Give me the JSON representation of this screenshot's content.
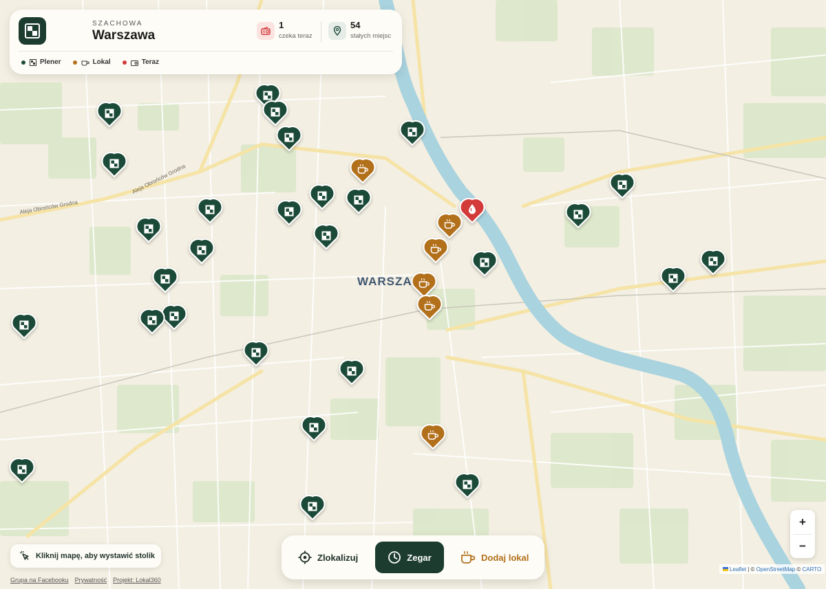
{
  "header": {
    "brand_small": "SZACHOWA",
    "brand_big": "Warszawa",
    "stats": [
      {
        "value": "1",
        "label": "czeka teraz",
        "icon": "radio-icon"
      },
      {
        "value": "54",
        "label": "stałych miejsc",
        "icon": "pin-icon"
      }
    ],
    "legend": [
      {
        "label": "Plener",
        "icon": "chessboard-icon",
        "color": "#1c4a38"
      },
      {
        "label": "Lokal",
        "icon": "coffee-icon",
        "color": "#b3701b"
      },
      {
        "label": "Teraz",
        "icon": "radio-icon",
        "color": "#d33a3a"
      }
    ]
  },
  "map": {
    "city_label": "WARSZAWA",
    "street_labels": [
      "Aleja Obrońców Grodna",
      "Aleja Obrońców Grodna"
    ]
  },
  "bottom_bar": {
    "locate": "Zlokalizuj",
    "clock": "Zegar",
    "add": "Dodaj lokal"
  },
  "hint": "Kliknij mapę, aby wystawić stolik",
  "footer": [
    "Grupa na Facebooku",
    "Prywatność",
    "Projekt: Lokal360"
  ],
  "zoom": {
    "in": "+",
    "out": "−"
  },
  "attribution": {
    "leaflet": "Leaflet",
    "sep1": " | © ",
    "osm": "OpenStreetMap",
    "sep2": " © ",
    "carto": "CARTO"
  },
  "colors": {
    "plener": "#1c4a38",
    "lokal": "#b3701b",
    "teraz": "#d33a3a",
    "river": "#a9d3df"
  }
}
